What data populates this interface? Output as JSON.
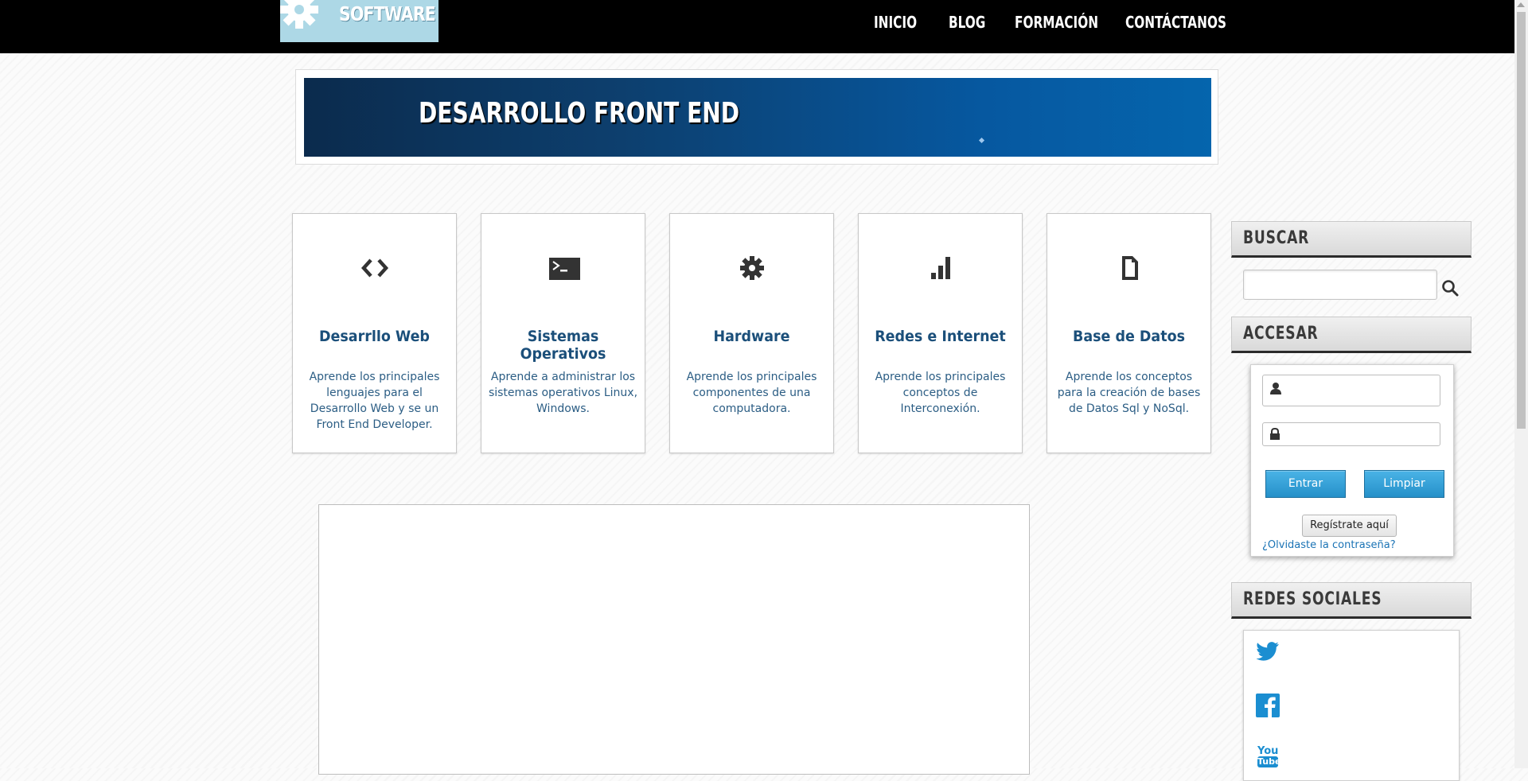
{
  "header": {
    "logo_text": "SOFTWARE",
    "nav": [
      "INICIO",
      "BLOG",
      "FORMACIÓN",
      "CONTÁCTANOS"
    ]
  },
  "hero": {
    "title": "DESARROLLO FRONT END"
  },
  "cards": [
    {
      "icon": "code-icon",
      "title": "Desarrllo Web",
      "description": "Aprende los principales lenguajes para el Desarrollo Web y se un Front End Developer."
    },
    {
      "icon": "terminal-icon",
      "title": "Sistemas Operativos",
      "description": "Aprende a administrar los sistemas operativos Linux, Windows."
    },
    {
      "icon": "gear-icon",
      "title": "Hardware",
      "description": "Aprende los principales componentes de una computadora."
    },
    {
      "icon": "signal-bars-icon",
      "title": "Redes e Internet",
      "description": "Aprende los principales conceptos de Interconexión."
    },
    {
      "icon": "document-icon",
      "title": "Base de Datos",
      "description": "Aprende los conceptos para la creación de bases de Datos Sql y NoSql."
    }
  ],
  "sidebar": {
    "search": {
      "heading": "BUSCAR",
      "value": "",
      "placeholder": ""
    },
    "login": {
      "heading": "ACCESAR",
      "username_value": "",
      "password_value": "",
      "submit_label": "Entrar",
      "clear_label": "Limpiar",
      "register_label": "Regístrate aquí",
      "forgot_label": "¿Olvidaste la contraseña?"
    },
    "social": {
      "heading": "REDES SOCIALES",
      "items": [
        "twitter-icon",
        "facebook-icon",
        "youtube-icon"
      ],
      "youtube_label_1": "You",
      "youtube_label_2": "Tube"
    }
  },
  "colors": {
    "topbar": "#000000",
    "logo_bg": "#add8e6",
    "hero_start": "#0b2b4d",
    "hero_end": "#0565ad",
    "card_title": "#1b4f7a",
    "button_blue": "#2590c9",
    "social_blue": "#1b8ed1"
  }
}
